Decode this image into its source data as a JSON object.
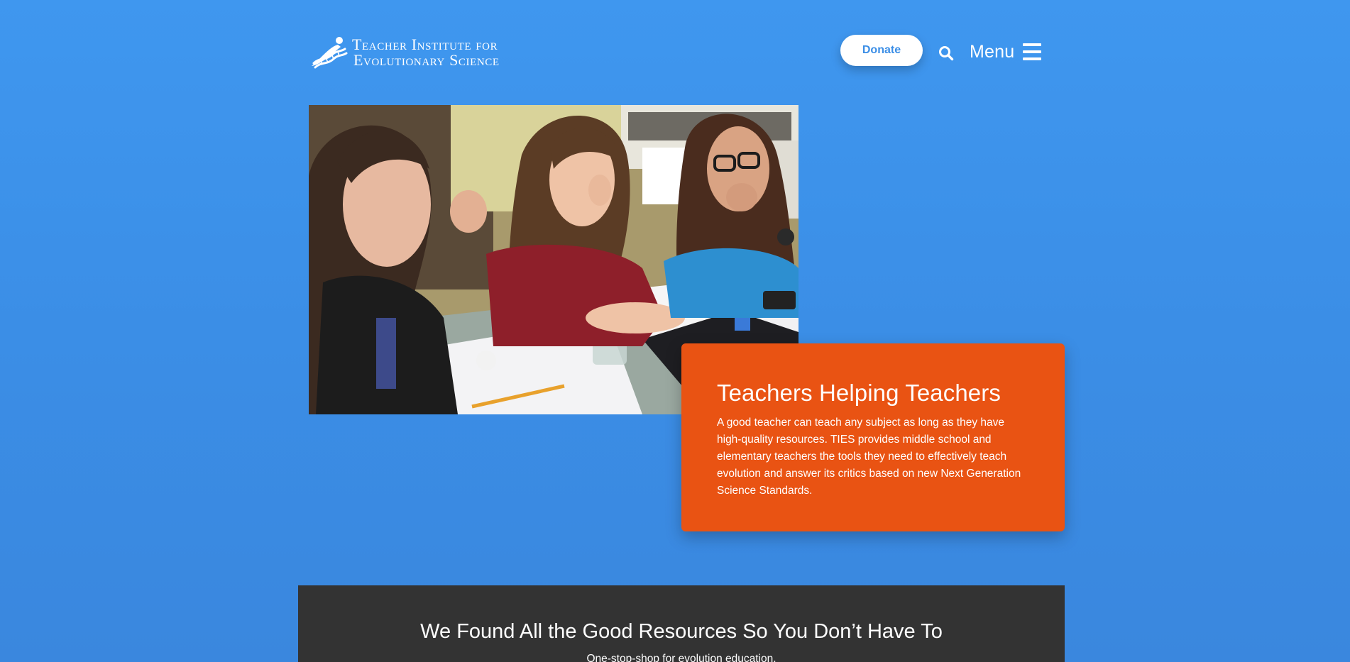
{
  "header": {
    "logo_line1": "Teacher Institute for",
    "logo_line2": "Evolutionary Science",
    "donate_label": "Donate",
    "menu_label": "Menu"
  },
  "icons": {
    "logo": "dna-figure-logo-icon",
    "search": "search-icon",
    "menu": "hamburger-menu-icon"
  },
  "hero": {
    "image_alt": "Three teachers laughing around a laptop at a table"
  },
  "feature": {
    "title": "Teachers Helping Teachers",
    "body": "A good teacher can teach any subject as long as they have high-quality resources. TIES provides middle school and elementary teachers the tools they need to effectively teach evolution and answer its critics based on new Next Generation Science Standards."
  },
  "resources": {
    "title": "We Found All the Good Resources So You Don’t Have To",
    "subtitle": "One-stop-shop for evolution education."
  },
  "colors": {
    "background": "#3b8ee6",
    "accent_orange": "#e95313",
    "dark_section": "#333333",
    "donate_text": "#3b8ee6"
  }
}
